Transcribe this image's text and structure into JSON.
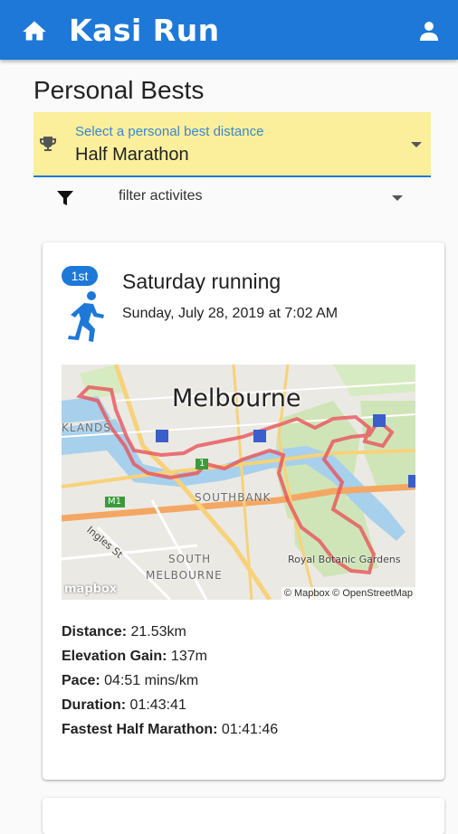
{
  "app": {
    "title": "Kasi Run"
  },
  "header": {
    "page_title": "Personal Bests"
  },
  "select": {
    "label": "Select a personal best distance",
    "value": "Half Marathon"
  },
  "filter": {
    "label": "filter activites"
  },
  "colors": {
    "primary": "#1e78d7",
    "select_bg": "#fbef9c",
    "route": "#e8535a"
  },
  "icons": {
    "home": "home-icon",
    "user": "user-icon",
    "trophy": "trophy-icon",
    "filter": "filter-icon",
    "run": "running-icon"
  },
  "activity": {
    "rank": "1st",
    "title": "Saturday running",
    "date": "Sunday, July 28, 2019 at 7:02 AM",
    "map": {
      "city": "Melbourne",
      "labels": {
        "southbank": "SOUTHBANK",
        "south": "SOUTH",
        "south_melbourne": "MELBOURNE",
        "lands": "KLANDS",
        "ingles": "Ingles St",
        "gardens": "Royal Botanic Gardens",
        "m1": "M1",
        "one": "1"
      },
      "attribution": "© Mapbox © OpenStreetMap",
      "logo": "mapbox"
    },
    "stats": [
      {
        "label": "Distance:",
        "value": " 21.53km"
      },
      {
        "label": "Elevation Gain:",
        "value": " 137m"
      },
      {
        "label": "Pace:",
        "value": " 04:51 mins/km"
      },
      {
        "label": "Duration:",
        "value": " 01:43:41"
      },
      {
        "label": "Fastest Half Marathon:",
        "value": " 01:41:46"
      }
    ]
  }
}
